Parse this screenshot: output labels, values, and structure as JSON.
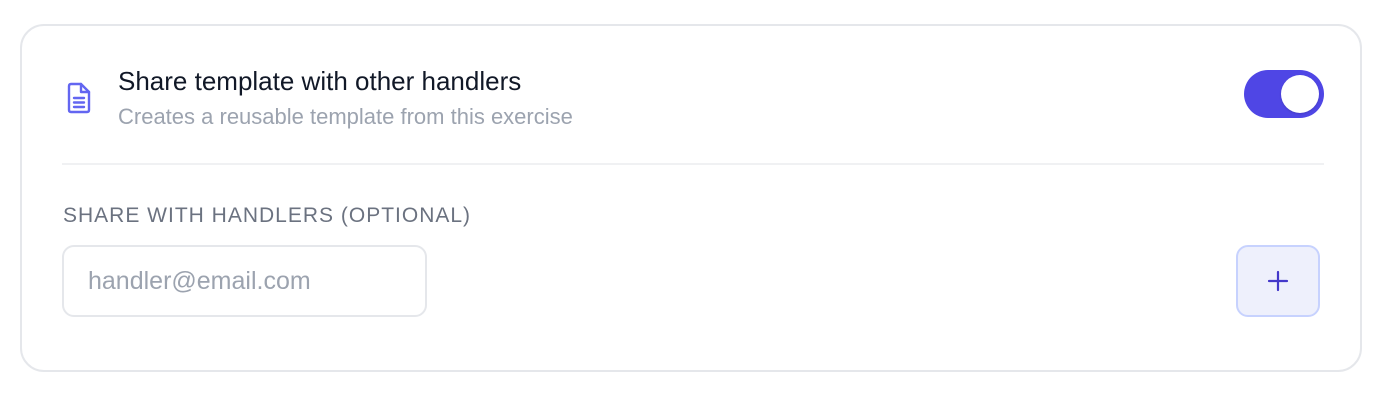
{
  "share_template": {
    "title": "Share template with other handlers",
    "description": "Creates a reusable template from this exercise",
    "icon": "document-icon",
    "toggle_enabled": true
  },
  "share_with": {
    "label": "SHARE WITH HANDLERS (OPTIONAL)",
    "email_placeholder": "handler@email.com",
    "email_value": "",
    "add_icon": "plus-icon"
  },
  "colors": {
    "accent": "#4f46e5",
    "accent_light": "#eef0fc",
    "text_primary": "#111827",
    "text_muted": "#9ca3af",
    "label": "#6b7280",
    "border": "#e5e7eb"
  }
}
